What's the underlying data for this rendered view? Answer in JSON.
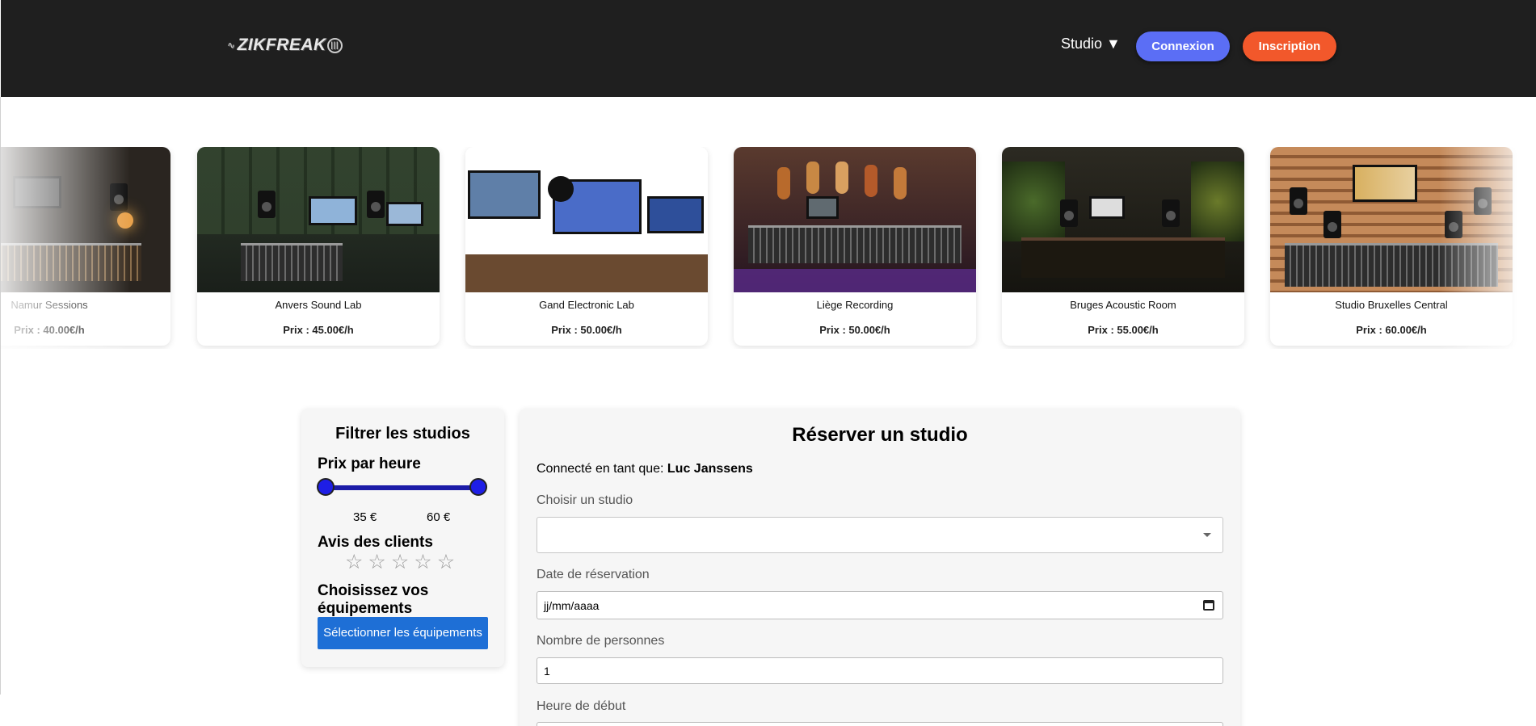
{
  "header": {
    "logo_text": "ZIKFREAK",
    "nav_studio": "Studio ▼",
    "connexion": "Connexion",
    "inscription": "Inscription"
  },
  "carousel": [
    {
      "name": "Namur Sessions",
      "price": "Prix : 40.00€/h"
    },
    {
      "name": "Anvers Sound Lab",
      "price": "Prix : 45.00€/h"
    },
    {
      "name": "Gand Electronic Lab",
      "price": "Prix : 50.00€/h"
    },
    {
      "name": "Liège Recording",
      "price": "Prix : 50.00€/h"
    },
    {
      "name": "Bruges Acoustic Room",
      "price": "Prix : 55.00€/h"
    },
    {
      "name": "Studio Bruxelles Central",
      "price": "Prix : 60.00€/h"
    }
  ],
  "filter": {
    "title": "Filtrer les studios",
    "price_label": "Prix par heure",
    "min": "35 €",
    "max": "60 €",
    "reviews_label": "Avis des clients",
    "stars": 0,
    "equip_label": "Choisissez vos équipements",
    "equip_button": "Sélectionner les équipements"
  },
  "form": {
    "title": "Réserver un studio",
    "connected_prefix": "Connecté en tant que:",
    "user": "Luc Janssens",
    "studio_label": "Choisir un studio",
    "studio_value": "",
    "date_label": "Date de réservation",
    "date_placeholder": "jj/mm/aaaa",
    "people_label": "Nombre de personnes",
    "people_value": "1",
    "start_label": "Heure de début"
  }
}
